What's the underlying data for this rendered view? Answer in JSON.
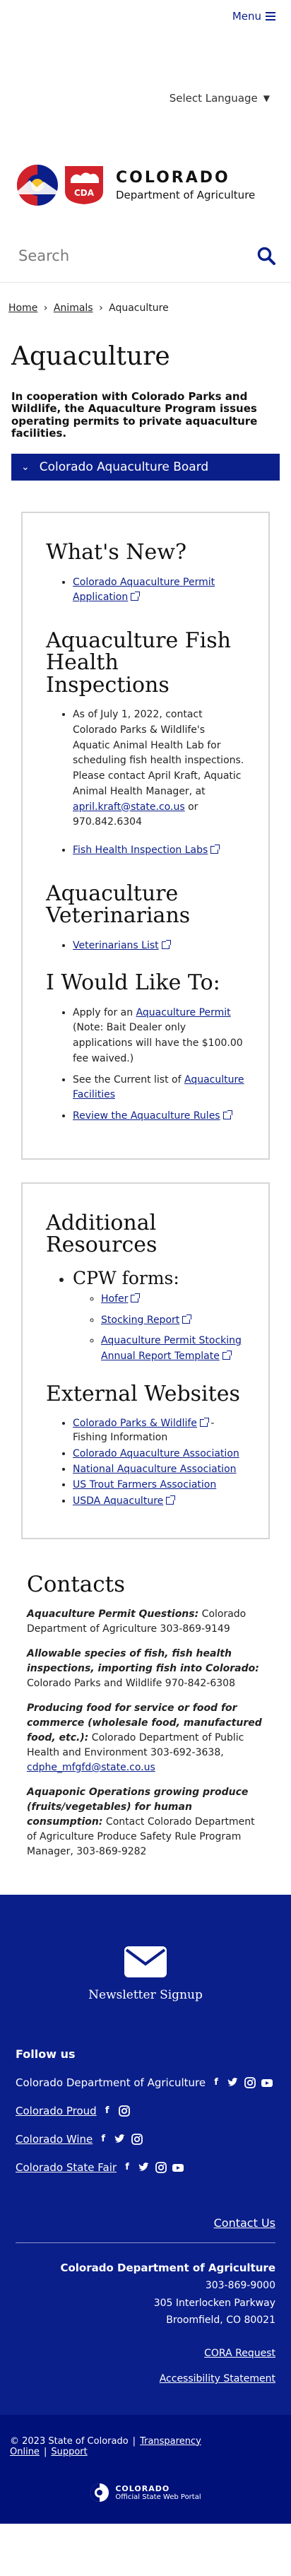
{
  "header": {
    "menu_label": "Menu",
    "language_label": "Select Language",
    "logo_state": "COLORADO",
    "logo_dept": "Department of Agriculture",
    "logo_badge_text": "CDA",
    "search_placeholder": "Search"
  },
  "breadcrumb": {
    "items": [
      "Home",
      "Animals",
      "Aquaculture"
    ]
  },
  "page": {
    "title": "Aquaculture",
    "intro": "In cooperation with Colorado Parks and Wildlife, the Aquaculture Program issues operating permits to private aquaculture facilities.",
    "accordion_label": "Colorado Aquaculture Board"
  },
  "card1": {
    "whats_new_heading": "What's New?",
    "whats_new_link": "Colorado Aquaculture Permit Application",
    "fish_health_heading": "Aquaculture Fish Health Inspections",
    "fish_health_text": "As of July 1, 2022, contact Colorado Parks & Wildlife's Aquatic Animal Health Lab for scheduling fish health inspections. Please contact April Kraft, Aquatic Animal Health Manager, at",
    "fish_health_email": "april.kraft@state.co.us",
    "fish_health_or": " or 970.842.6304",
    "fish_health_link": "Fish Health Inspection Labs",
    "vets_heading": "Aquaculture Veterinarians",
    "vets_link": "Veterinarians List",
    "would_like_heading": "I Would Like To:",
    "apply_pre": "Apply for an ",
    "apply_link": "Aquaculture Permit",
    "apply_note": " (Note: Bait Dealer only applications will have the $100.00 fee waived.)",
    "current_list_pre": "See the Current list of ",
    "current_list_link": "Aquaculture Facilities",
    "review_rules_link": "Review the Aquaculture Rules"
  },
  "card2": {
    "resources_heading": "Additional Resources",
    "cpw_forms_heading": "CPW forms:",
    "cpw_forms": [
      "Hofer",
      "Stocking Report",
      "Aquaculture Permit Stocking Annual Report Template"
    ],
    "external_heading": "External Websites",
    "cpw_link": "Colorado Parks & Wildlife",
    "cpw_suffix": " - Fishing Information",
    "external_links": [
      "Colorado Aquaculture Association",
      "National Aquaculture Association",
      "US Trout Farmers Association",
      "USDA Aquaculture"
    ]
  },
  "contacts": {
    "heading": "Contacts",
    "items": [
      {
        "label": "Aquaculture Permit Questions:",
        "text": " Colorado Department of Agriculture 303-869-9149",
        "email": ""
      },
      {
        "label": "Allowable species of fish, fish health inspections, importing fish into Colorado:",
        "text": " Colorado Parks and Wildlife 970-842-6308",
        "email": ""
      },
      {
        "label": "Producing food for service or food for commerce (wholesale food, manufactured food, etc.):",
        "text": " Colorado Department of Public Health and Environment 303-692-3638, ",
        "email": "cdphe_mfgfd@state.co.us"
      },
      {
        "label": "Aquaponic Operations growing produce (fruits/vegetables) for human consumption:",
        "text": " Contact Colorado Department of Agriculture Produce Safety Rule Program Manager, 303-869-9282",
        "email": ""
      }
    ]
  },
  "footer": {
    "newsletter_label": "Newsletter Signup",
    "follow_heading": "Follow us",
    "social_rows": [
      {
        "name": "Colorado Department of Agriculture",
        "icons": [
          "facebook-icon",
          "twitter-icon",
          "instagram-icon",
          "youtube-icon"
        ]
      },
      {
        "name": "Colorado Proud",
        "icons": [
          "facebook-icon",
          "instagram-icon"
        ]
      },
      {
        "name": "Colorado Wine",
        "icons": [
          "facebook-icon",
          "twitter-icon",
          "instagram-icon"
        ]
      },
      {
        "name": "Colorado State Fair",
        "icons": [
          "facebook-icon",
          "twitter-icon",
          "instagram-icon",
          "youtube-icon"
        ]
      }
    ],
    "contact_us": "Contact Us",
    "org": "Colorado Department of Agriculture",
    "phone": "303-869-9000",
    "street": "305 Interlocken Parkway",
    "city": "Broomfield, CO 80021",
    "cora": "CORA Request",
    "accessibility": "Accessibility Statement",
    "copyright": "© 2023 State of Colorado",
    "transparency": "Transparency Online",
    "support": "Support",
    "portal_a": "COLORADO",
    "portal_b": "Official State Web Portal"
  },
  "colors": {
    "primary_blue": "#0b1f8a",
    "footer_dark": "#00117a",
    "logo_red": "#d2232a",
    "logo_yellow": "#f3c12d"
  }
}
